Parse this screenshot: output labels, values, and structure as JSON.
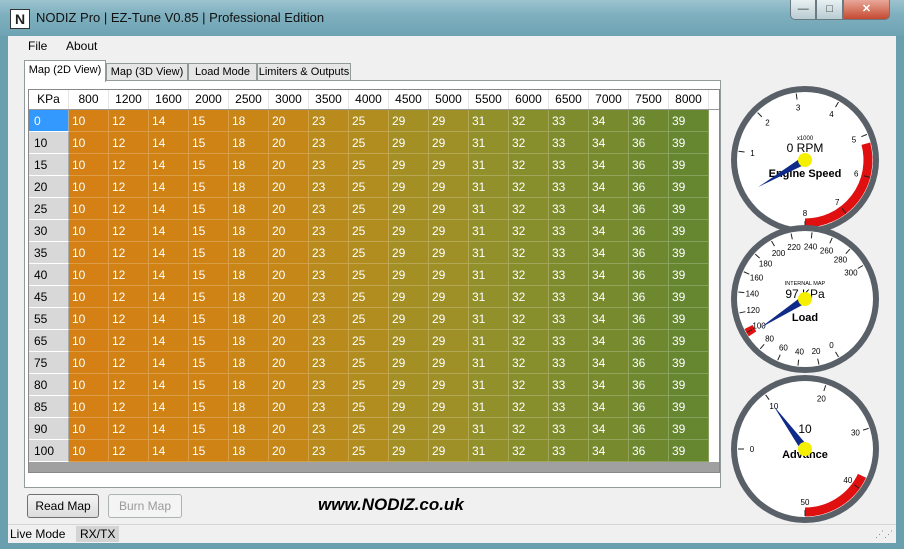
{
  "window": {
    "title": "NODIZ Pro | EZ-Tune V0.85 | Professional Edition",
    "icon": "nodiz-logo-icon",
    "icon_glyph": "N",
    "min_glyph": "—",
    "max_glyph": "□",
    "close_glyph": "✕"
  },
  "menu": [
    "File",
    "About"
  ],
  "tabs": [
    "Map (2D View)",
    "Map (3D View)",
    "Load Mode",
    "Limiters & Outputs"
  ],
  "active_tab": 0,
  "grid": {
    "corner_label": "KPa",
    "columns": [
      "800",
      "1200",
      "1600",
      "2000",
      "2500",
      "3000",
      "3500",
      "4000",
      "4500",
      "5000",
      "5500",
      "6000",
      "6500",
      "7000",
      "7500",
      "8000"
    ],
    "rows": [
      "0",
      "10",
      "15",
      "20",
      "25",
      "30",
      "35",
      "40",
      "45",
      "55",
      "65",
      "75",
      "80",
      "85",
      "90",
      "100"
    ],
    "row_values": [
      "10",
      "12",
      "14",
      "15",
      "18",
      "20",
      "23",
      "25",
      "29",
      "29",
      "31",
      "32",
      "33",
      "34",
      "36",
      "39"
    ],
    "selected_row": 0,
    "colors": [
      "#d48014",
      "#d28114",
      "#d08214",
      "#ce8314",
      "#c98516",
      "#c48718",
      "#b98b1c",
      "#b18d20",
      "#a38f24",
      "#9e9027",
      "#92902a",
      "#878e2c",
      "#7f8c2e",
      "#778a2e",
      "#6e882f",
      "#668630"
    ]
  },
  "buttons": {
    "read_map": "Read Map",
    "burn_map": "Burn Map"
  },
  "website": "www.NODIZ.co.uk",
  "status": {
    "mode": "Live Mode",
    "rx_tx": "RX/TX"
  },
  "gauges": {
    "rpm": {
      "title": "Engine Speed",
      "multiplier": "x1000",
      "readout": "0 RPM",
      "value": 0,
      "min": 0,
      "max": 8,
      "ticks": [
        "1",
        "2",
        "3",
        "4",
        "5",
        "6",
        "7",
        "8"
      ],
      "redline_from": 5.2
    },
    "load": {
      "title": "Load",
      "subtitle": "INTERNAL MAP",
      "readout": "97 KPa",
      "value": 97,
      "min": 0,
      "max": 300,
      "ticks": [
        "0",
        "20",
        "40",
        "60",
        "80",
        "100",
        "120",
        "140",
        "160",
        "180",
        "200",
        "220",
        "240",
        "260",
        "280",
        "300"
      ],
      "red_from": 96,
      "red_to": 104
    },
    "advance": {
      "title": "Advance",
      "readout": "10",
      "value": 10,
      "min": 0,
      "max": 50,
      "ticks": [
        "0",
        "10",
        "20",
        "30",
        "40",
        "50"
      ],
      "redline_from": 38
    },
    "accent_red": "#e01010",
    "needle": "#102a8a",
    "hub": "#f5f000"
  }
}
